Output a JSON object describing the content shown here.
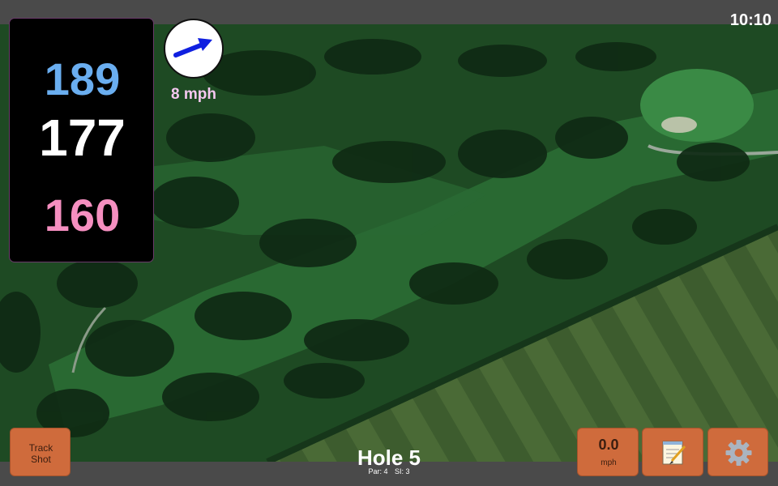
{
  "status_bar": {
    "time": "10:10"
  },
  "distances": {
    "back": "189",
    "middle": "177",
    "front": "160"
  },
  "wind": {
    "speed": "8 mph",
    "arrow_color": "#1020e0"
  },
  "hole": {
    "title": "Hole 5",
    "par": "Par: 4",
    "stroke_index": "SI: 3"
  },
  "controls": {
    "track_shot_line1": "Track",
    "track_shot_line2": "Shot",
    "speed_value": "0.0",
    "speed_unit": "mph",
    "notes_icon": "notepad-icon",
    "settings_icon": "gear-icon"
  },
  "colors": {
    "back_distance": "#6aaef0",
    "middle_distance": "#ffffff",
    "front_distance": "#f58fc0",
    "button": "#cf6b3c",
    "fairway": "#2f7a3a",
    "trees": "#0f2a14"
  }
}
